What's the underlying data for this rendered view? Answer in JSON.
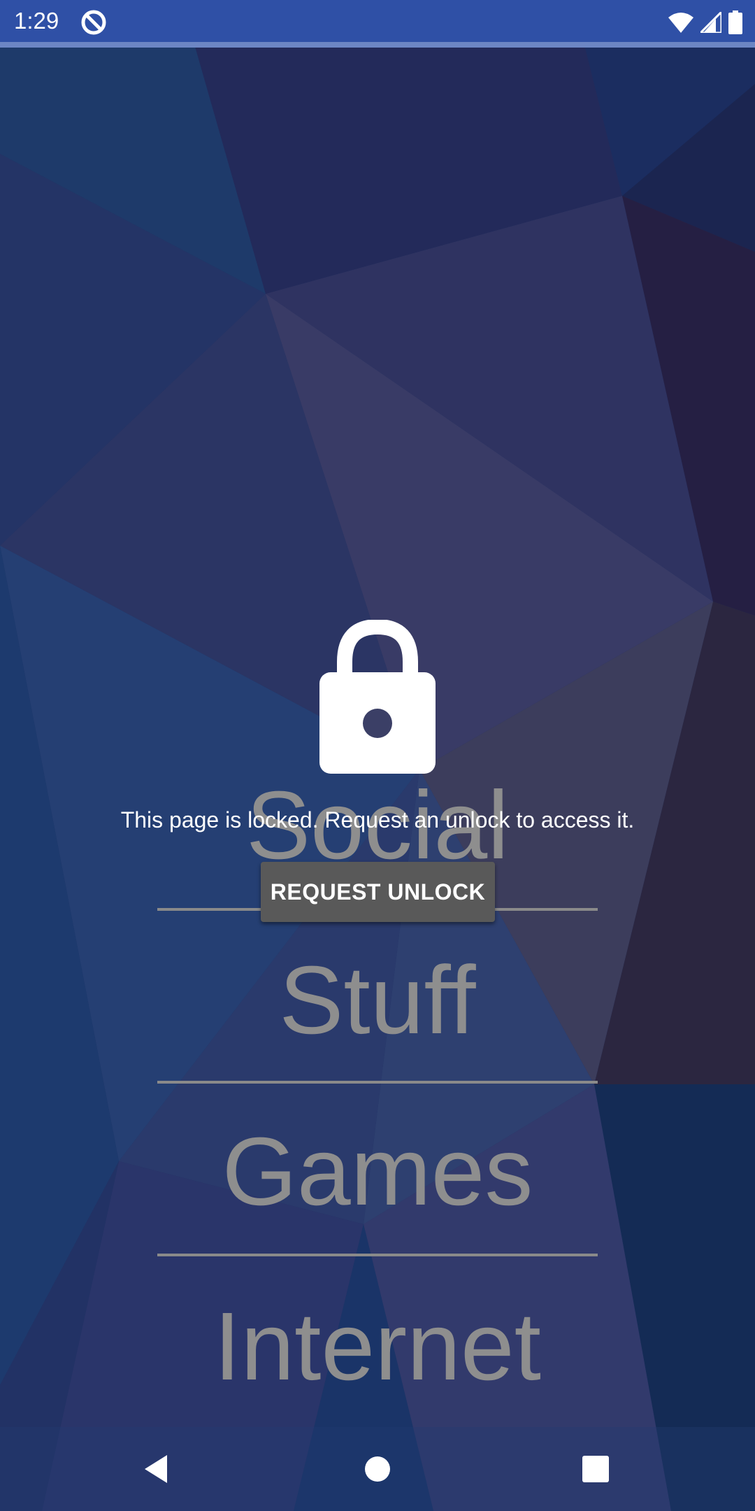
{
  "status_bar": {
    "time": "1:29",
    "app_icon": "data-saver-icon",
    "icons": [
      "wifi-icon",
      "signal-icon",
      "battery-icon"
    ]
  },
  "menu": {
    "items": [
      {
        "label": "Social"
      },
      {
        "label": "Stuff"
      },
      {
        "label": "Games"
      },
      {
        "label": "Internet"
      }
    ]
  },
  "lock_overlay": {
    "icon": "lock-icon",
    "message": "This page is locked. Request an unlock to access it.",
    "button_label": "REQUEST UNLOCK"
  },
  "nav_bar": {
    "buttons": [
      "back-icon",
      "home-icon",
      "recents-icon"
    ]
  },
  "colors": {
    "wallpaper_base": "#1f3262",
    "status_bar": "#2f50a6",
    "menu_text": "#8e8e8e",
    "button_bg": "#595959"
  }
}
